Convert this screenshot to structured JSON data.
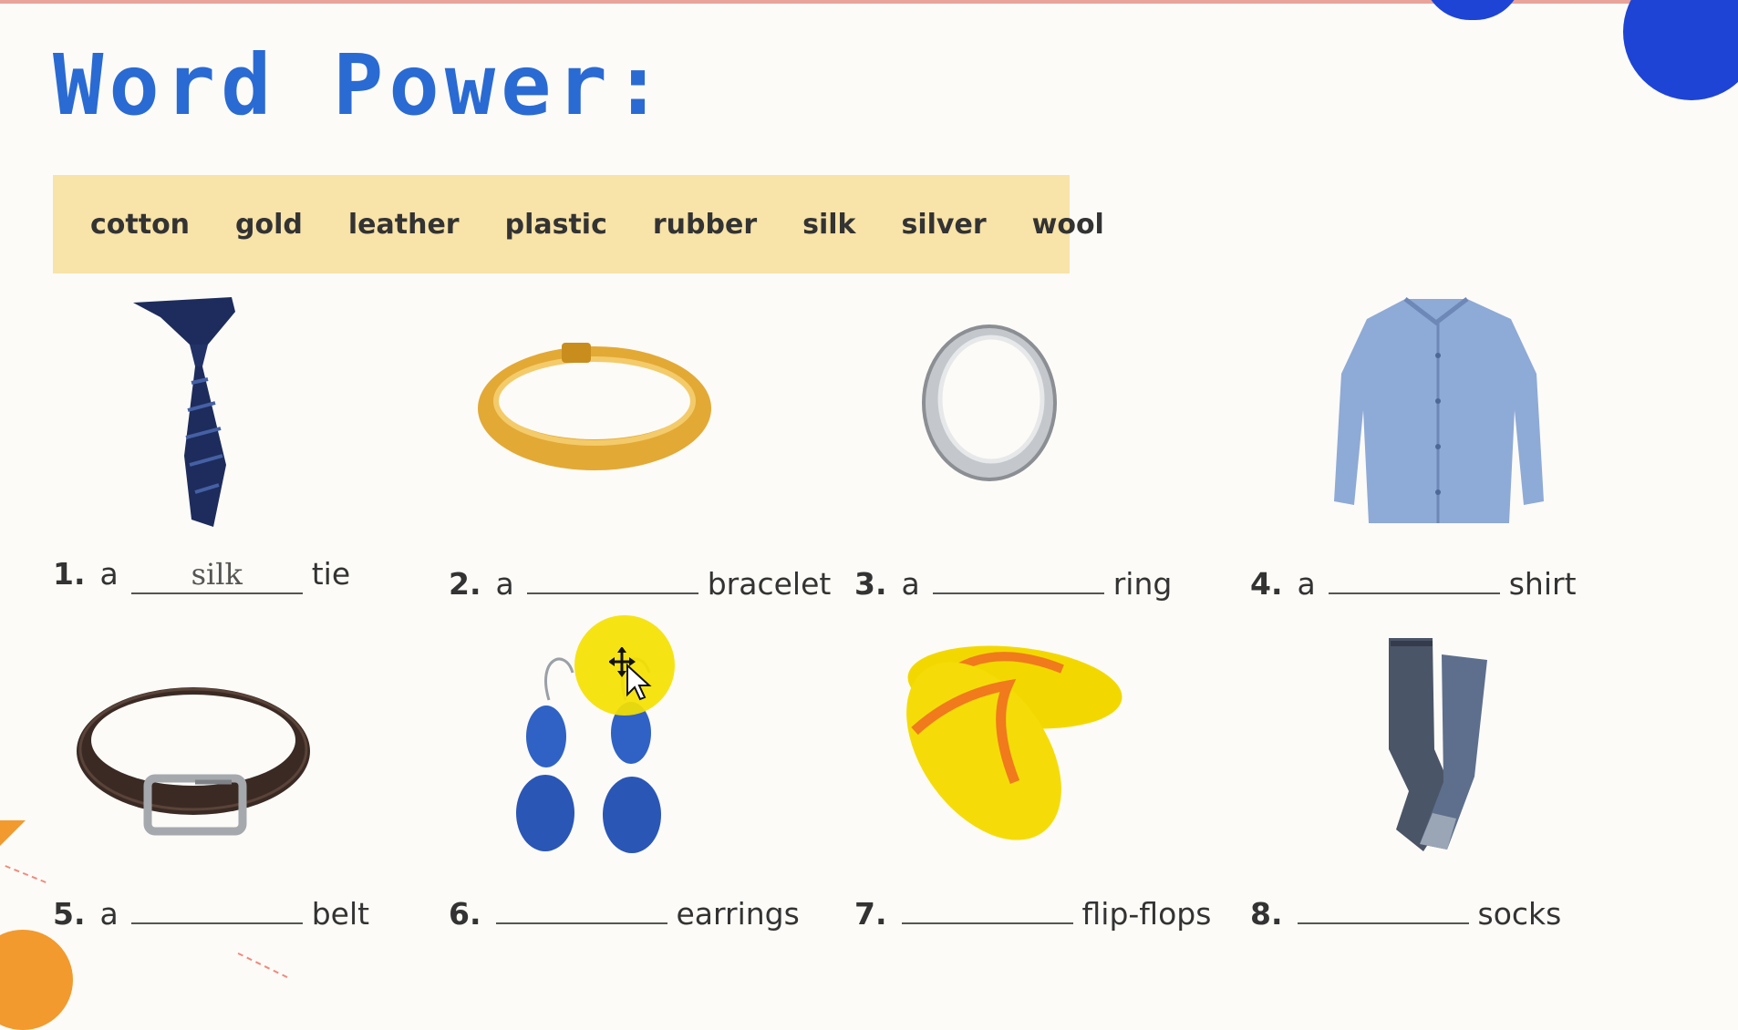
{
  "title": "Word Power:",
  "word_bank": [
    "cotton",
    "gold",
    "leather",
    "plastic",
    "rubber",
    "silk",
    "silver",
    "wool"
  ],
  "items": [
    {
      "number": "1.",
      "article": "a",
      "answer": "silk",
      "noun": "tie",
      "icon": "tie-icon"
    },
    {
      "number": "2.",
      "article": "a",
      "answer": "",
      "noun": "bracelet",
      "icon": "bracelet-icon"
    },
    {
      "number": "3.",
      "article": "a",
      "answer": "",
      "noun": "ring",
      "icon": "ring-icon"
    },
    {
      "number": "4.",
      "article": "a",
      "answer": "",
      "noun": "shirt",
      "icon": "shirt-icon"
    },
    {
      "number": "5.",
      "article": "a",
      "answer": "",
      "noun": "belt",
      "icon": "belt-icon"
    },
    {
      "number": "6.",
      "article": "",
      "answer": "",
      "noun": "earrings",
      "icon": "earrings-icon"
    },
    {
      "number": "7.",
      "article": "",
      "answer": "",
      "noun": "flip-flops",
      "icon": "flip-flops-icon"
    },
    {
      "number": "8.",
      "article": "",
      "answer": "",
      "noun": "socks",
      "icon": "socks-icon"
    }
  ],
  "colors": {
    "title": "#2a6ad3",
    "word_bank_bg": "#f8e3a8",
    "highlight": "#f5e100",
    "accent_blue": "#1e44d6",
    "accent_orange": "#f29a2e"
  }
}
